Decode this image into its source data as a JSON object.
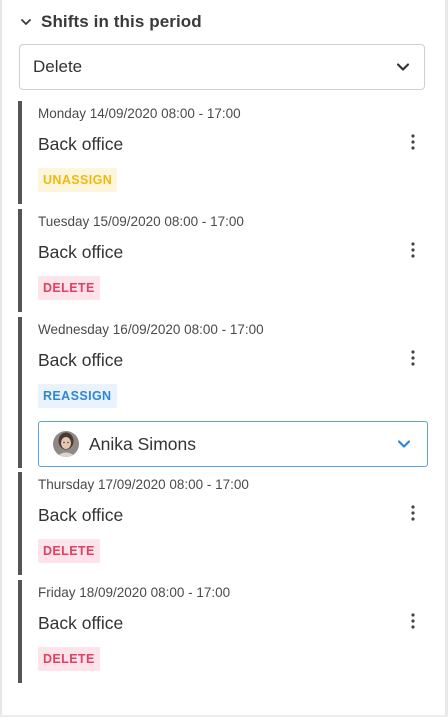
{
  "section": {
    "title": "Shifts in this period"
  },
  "action_select": {
    "value": "Delete"
  },
  "shifts": [
    {
      "date": "Monday 14/09/2020 08:00 - 17:00",
      "name": "Back office",
      "badge": "UNASSIGN"
    },
    {
      "date": "Tuesday 15/09/2020 08:00 - 17:00",
      "name": "Back office",
      "badge": "DELETE"
    },
    {
      "date": "Wednesday 16/09/2020 08:00 - 17:00",
      "name": "Back office",
      "badge": "REASSIGN",
      "assignee": "Anika Simons"
    },
    {
      "date": "Thursday 17/09/2020 08:00 - 17:00",
      "name": "Back office",
      "badge": "DELETE"
    },
    {
      "date": "Friday 18/09/2020 08:00 - 17:00",
      "name": "Back office",
      "badge": "DELETE"
    }
  ],
  "icons": {
    "section_toggle": "chevron-down-icon",
    "select_caret": "chevron-down-icon",
    "shift_menu": "more-vertical-icon",
    "assignee_caret": "chevron-down-icon"
  },
  "colors": {
    "card_border": "#555555",
    "unassign": "#f2b80d",
    "delete": "#e23f63",
    "reassign": "#2f86d8",
    "select_focus_border": "#5aa2e0"
  }
}
